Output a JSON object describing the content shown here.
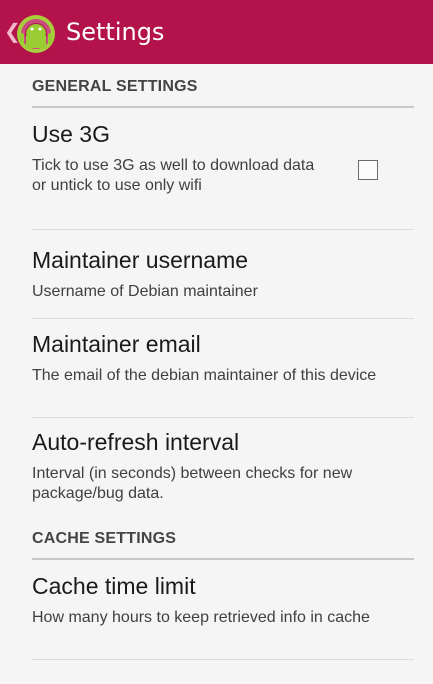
{
  "action_bar": {
    "title": "Settings",
    "up_icon": "chevron-left-icon",
    "app_icon": "android-icon",
    "color": "#b3124b"
  },
  "general": {
    "header": "GENERAL SETTINGS",
    "use_3g": {
      "title": "Use 3G",
      "summary": "Tick to use 3G as well to download data or untick to use only wifi",
      "checked": false
    },
    "maintainer_username": {
      "title": "Maintainer username",
      "summary": "Username of Debian maintainer"
    },
    "maintainer_email": {
      "title": "Maintainer email",
      "summary": "The email of the debian maintainer of this device"
    },
    "refresh_interval": {
      "title": "Auto-refresh interval",
      "summary": "Interval (in seconds) between checks for new package/bug data."
    }
  },
  "cache": {
    "header": "CACHE SETTINGS",
    "time_limit": {
      "title": "Cache time limit",
      "summary": "How many hours to keep retrieved info in cache"
    }
  }
}
